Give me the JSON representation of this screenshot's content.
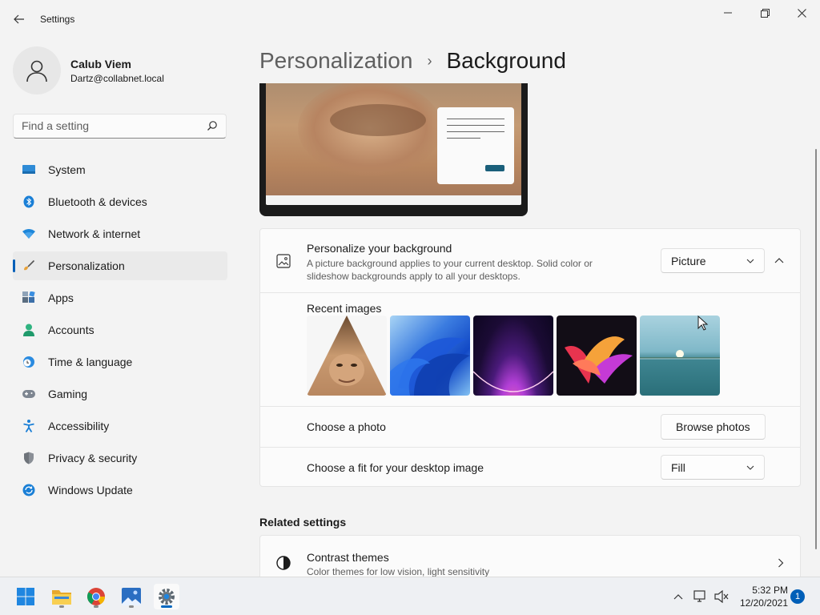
{
  "titlebar": {
    "app_title": "Settings",
    "minimize_icon": "minimize-icon",
    "maximize_icon": "restore-icon",
    "close_icon": "close-icon"
  },
  "user": {
    "name": "Calub Viem",
    "email": "Dartz@collabnet.local"
  },
  "search": {
    "placeholder": "Find a setting"
  },
  "sidebar": {
    "items": [
      {
        "label": "System",
        "icon": "system-icon",
        "active": false
      },
      {
        "label": "Bluetooth & devices",
        "icon": "bluetooth-icon",
        "active": false
      },
      {
        "label": "Network & internet",
        "icon": "network-icon",
        "active": false
      },
      {
        "label": "Personalization",
        "icon": "personalization-brush-icon",
        "active": true
      },
      {
        "label": "Apps",
        "icon": "apps-icon",
        "active": false
      },
      {
        "label": "Accounts",
        "icon": "accounts-icon",
        "active": false
      },
      {
        "label": "Time & language",
        "icon": "time-language-icon",
        "active": false
      },
      {
        "label": "Gaming",
        "icon": "gaming-icon",
        "active": false
      },
      {
        "label": "Accessibility",
        "icon": "accessibility-icon",
        "active": false
      },
      {
        "label": "Privacy & security",
        "icon": "privacy-shield-icon",
        "active": false
      },
      {
        "label": "Windows Update",
        "icon": "windows-update-icon",
        "active": false
      }
    ]
  },
  "breadcrumb": {
    "parent": "Personalization",
    "separator": "›",
    "current": "Background"
  },
  "background_card": {
    "title": "Personalize your background",
    "description": "A picture background applies to your current desktop. Solid color or slideshow backgrounds apply to all your desktops.",
    "dropdown_value": "Picture",
    "recent_images_label": "Recent images",
    "recent_images": [
      "pyramid-face",
      "windows-11-bloom-blue",
      "purple-glow-arc",
      "colorful-ribbons",
      "lake-sunrise"
    ],
    "choose_photo_label": "Choose a photo",
    "browse_button": "Browse photos",
    "fit_label": "Choose a fit for your desktop image",
    "fit_value": "Fill"
  },
  "related": {
    "heading": "Related settings",
    "items": [
      {
        "title": "Contrast themes",
        "description": "Color themes for low vision, light sensitivity"
      }
    ]
  },
  "taskbar": {
    "apps": [
      "start-icon",
      "file-explorer-icon",
      "chrome-icon",
      "photos-icon",
      "settings-gear-icon"
    ],
    "time": "5:32 PM",
    "date": "12/20/2021",
    "notification_count": "1"
  },
  "colors": {
    "accent": "#005fb8",
    "background": "#f3f3f3",
    "card": "#fbfbfb"
  }
}
